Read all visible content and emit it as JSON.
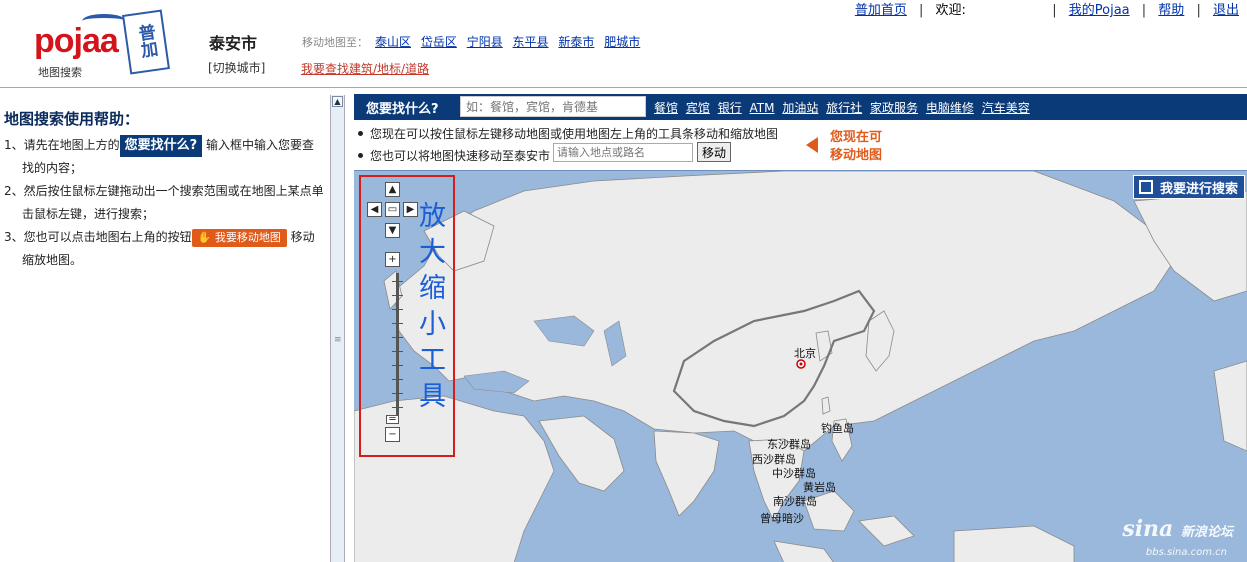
{
  "header": {
    "logo_word": "pojaa",
    "logo_badge": "普加",
    "logo_sub": "地图搜索",
    "city": "泰安市",
    "switch_city": "[切换城市]",
    "goto_label": "移动地图至：",
    "goto_links": [
      "泰山区",
      "岱岳区",
      "宁阳县",
      "东平县",
      "新泰市",
      "肥城市"
    ],
    "find_link": "我要查找建筑/地标/道路"
  },
  "topnav": {
    "home": "普加首页",
    "welcome": "欢迎:",
    "my_pojaa": "我的Pojaa",
    "help": "帮助",
    "logout": "退出"
  },
  "help": {
    "title": "地图搜索使用帮助：",
    "step1_prefix": "1、请先在地图上方的",
    "step1_pill": "您要找什么?",
    "step1_suffix": "输入框中输入您要查",
    "step1_cont": "找的内容；",
    "step2_a": "2、然后按住鼠标左键拖动出一个搜索范围或在地图上某点单",
    "step2_b": "击鼠标左键，进行搜索；",
    "step3_prefix": "3、您也可以点击地图右上角的按钮",
    "step3_pill": "我要移动地图",
    "step3_suffix": "移动",
    "step3_cont": "缩放地图。"
  },
  "search": {
    "label": "您要找什么?",
    "placeholder": "如：餐馆，宾馆，肯德基",
    "categories": [
      "餐馆",
      "宾馆",
      "银行",
      "ATM",
      "加油站",
      "旅行社",
      "家政服务",
      "电脑维修",
      "汽车美容"
    ]
  },
  "info": {
    "line1": "您现在可以按住鼠标左键移动地图或使用地图左上角的工具条移动和缩放地图",
    "line2": "您也可以将地图快速移动至泰安市",
    "place_placeholder": "请输入地点或路名",
    "move_button": "移动",
    "can_move_1": "您现在可",
    "can_move_2": "移动地图"
  },
  "map": {
    "zoom_tool_label": "放大缩小工具",
    "start_search": "我要进行搜索",
    "labels": {
      "beijing": "北京",
      "diaoyu": "钓鱼岛",
      "dongsha": "东沙群岛",
      "xisha": "西沙群岛",
      "zhongsha": "中沙群岛",
      "huangyan": "黄岩岛",
      "nansha": "南沙群岛",
      "zengmu": "曾母暗沙"
    },
    "watermark": "sina",
    "watermark_cn": "新浪论坛",
    "watermark_url": "bbs.sina.com.cn"
  },
  "colors": {
    "brand_blue": "#0b3a78",
    "brand_red": "#d4141c",
    "accent_orange": "#e05a1a",
    "sea": "#9ab8db",
    "land": "#ececec"
  }
}
